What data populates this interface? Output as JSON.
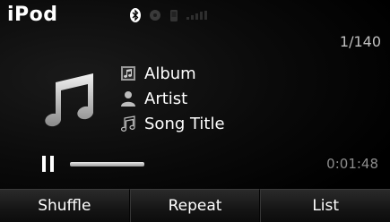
{
  "header": {
    "title": "iPod",
    "status_icons": [
      "bluetooth-icon",
      "disc-icon",
      "phone-icon",
      "signal-icon"
    ]
  },
  "track": {
    "counter": "1/140",
    "album": "Album",
    "artist": "Artist",
    "song_title": "Song Title"
  },
  "playback": {
    "state_icon": "pause-icon",
    "elapsed": "0:01:48",
    "progress_fraction": 0.25
  },
  "bottom_bar": {
    "shuffle_label": "Shuffle",
    "repeat_label": "Repeat",
    "list_label": "List"
  },
  "colors": {
    "background": "#000000",
    "text": "#ffffff",
    "dim_text": "#8c8c8c"
  }
}
